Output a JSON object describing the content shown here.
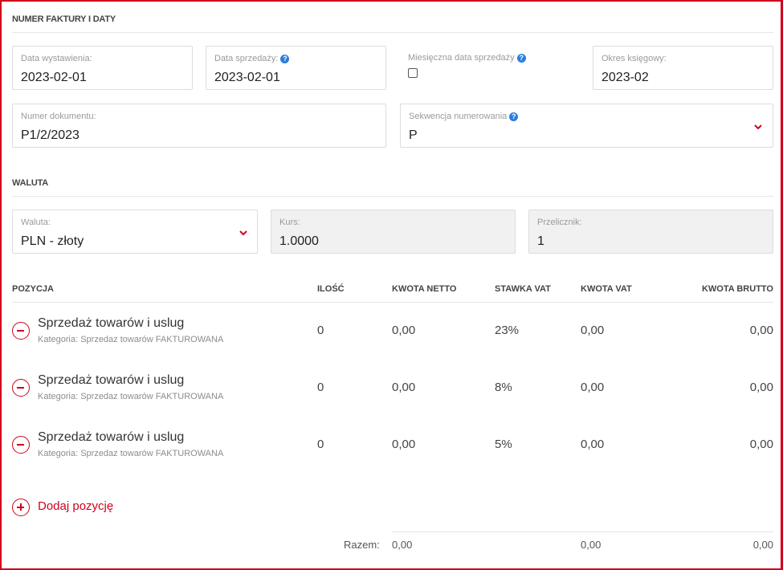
{
  "sections": {
    "invoice_title": "NUMER FAKTURY I DATY",
    "currency_title": "WALUTA"
  },
  "fields": {
    "issue_date_label": "Data wystawienia:",
    "issue_date_value": "2023-02-01",
    "sale_date_label": "Data sprzedaży:",
    "sale_date_value": "2023-02-01",
    "monthly_sale_date_label": "Miesięczna data sprzedaży",
    "accounting_period_label": "Okres księgowy:",
    "accounting_period_value": "2023-02",
    "document_number_label": "Numer dokumentu:",
    "document_number_value": "P1/2/2023",
    "numbering_sequence_label": "Sekwencja numerowania",
    "numbering_sequence_value": "P",
    "currency_label": "Waluta:",
    "currency_value": "PLN - złoty",
    "rate_label": "Kurs:",
    "rate_value": "1.0000",
    "converter_label": "Przelicznik:",
    "converter_value": "1"
  },
  "table": {
    "headers": {
      "position": "POZYCJA",
      "quantity": "ILOŚĆ",
      "net": "KWOTA NETTO",
      "vat_rate": "STAWKA VAT",
      "vat_amount": "KWOTA VAT",
      "gross": "KWOTA BRUTTO"
    },
    "rows": [
      {
        "name": "Sprzedaż towarów i uslug",
        "category": "Kategoria: Sprzedaz towarów FAKTUROWANA",
        "quantity": "0",
        "net": "0,00",
        "vat_rate": "23%",
        "vat_amount": "0,00",
        "gross": "0,00"
      },
      {
        "name": "Sprzedaż towarów i uslug",
        "category": "Kategoria: Sprzedaz towarów FAKTUROWANA",
        "quantity": "0",
        "net": "0,00",
        "vat_rate": "8%",
        "vat_amount": "0,00",
        "gross": "0,00"
      },
      {
        "name": "Sprzedaż towarów i uslug",
        "category": "Kategoria: Sprzedaz towarów FAKTUROWANA",
        "quantity": "0",
        "net": "0,00",
        "vat_rate": "5%",
        "vat_amount": "0,00",
        "gross": "0,00"
      }
    ],
    "add_label": "Dodaj pozycję",
    "totals": {
      "label": "Razem:",
      "net": "0,00",
      "vat_amount": "0,00",
      "gross": "0,00"
    }
  },
  "colors": {
    "accent": "#d0021b",
    "help": "#2a7de1"
  },
  "icons": {
    "help": "question-circle",
    "dropdown": "chevron-down",
    "remove": "minus-circle",
    "add": "plus-circle"
  },
  "help_glyph": "?"
}
